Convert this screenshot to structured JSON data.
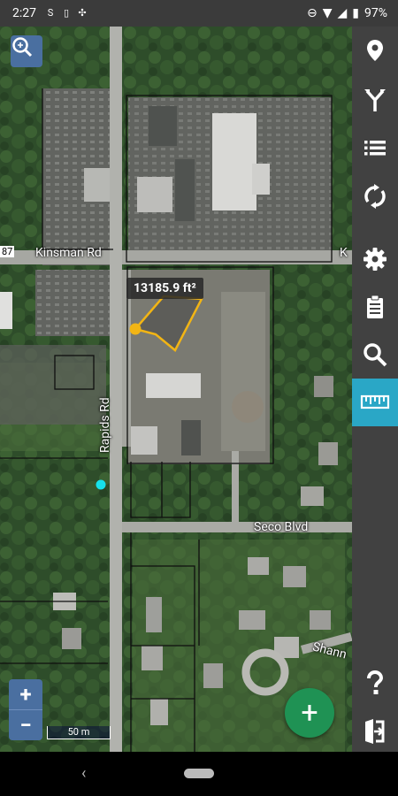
{
  "status_bar": {
    "time": "2:27",
    "battery": "97%"
  },
  "map": {
    "roads": {
      "kinsman": "Kinsman Rd",
      "rapids": "Rapids Rd",
      "seco": "Seco Blvd",
      "shannon": "Shann",
      "k_cut": "K",
      "route_cut": "87"
    },
    "measurement": "13185.9 ft²",
    "scale_label": "50 m"
  },
  "zoom": {
    "in_label": "+",
    "out_label": "−"
  },
  "fab_label": "+",
  "toolbar": {
    "items": [
      {
        "name": "location-pin-icon"
      },
      {
        "name": "merge-icon"
      },
      {
        "name": "list-icon"
      },
      {
        "name": "sync-icon"
      },
      {
        "name": "settings-icon"
      },
      {
        "name": "clipboard-icon"
      },
      {
        "name": "search-icon"
      },
      {
        "name": "ruler-icon",
        "active": true
      },
      {
        "name": "help-icon"
      },
      {
        "name": "exit-icon"
      }
    ],
    "accent_color": "#2aa7c6",
    "fab_color": "#1f9254"
  }
}
